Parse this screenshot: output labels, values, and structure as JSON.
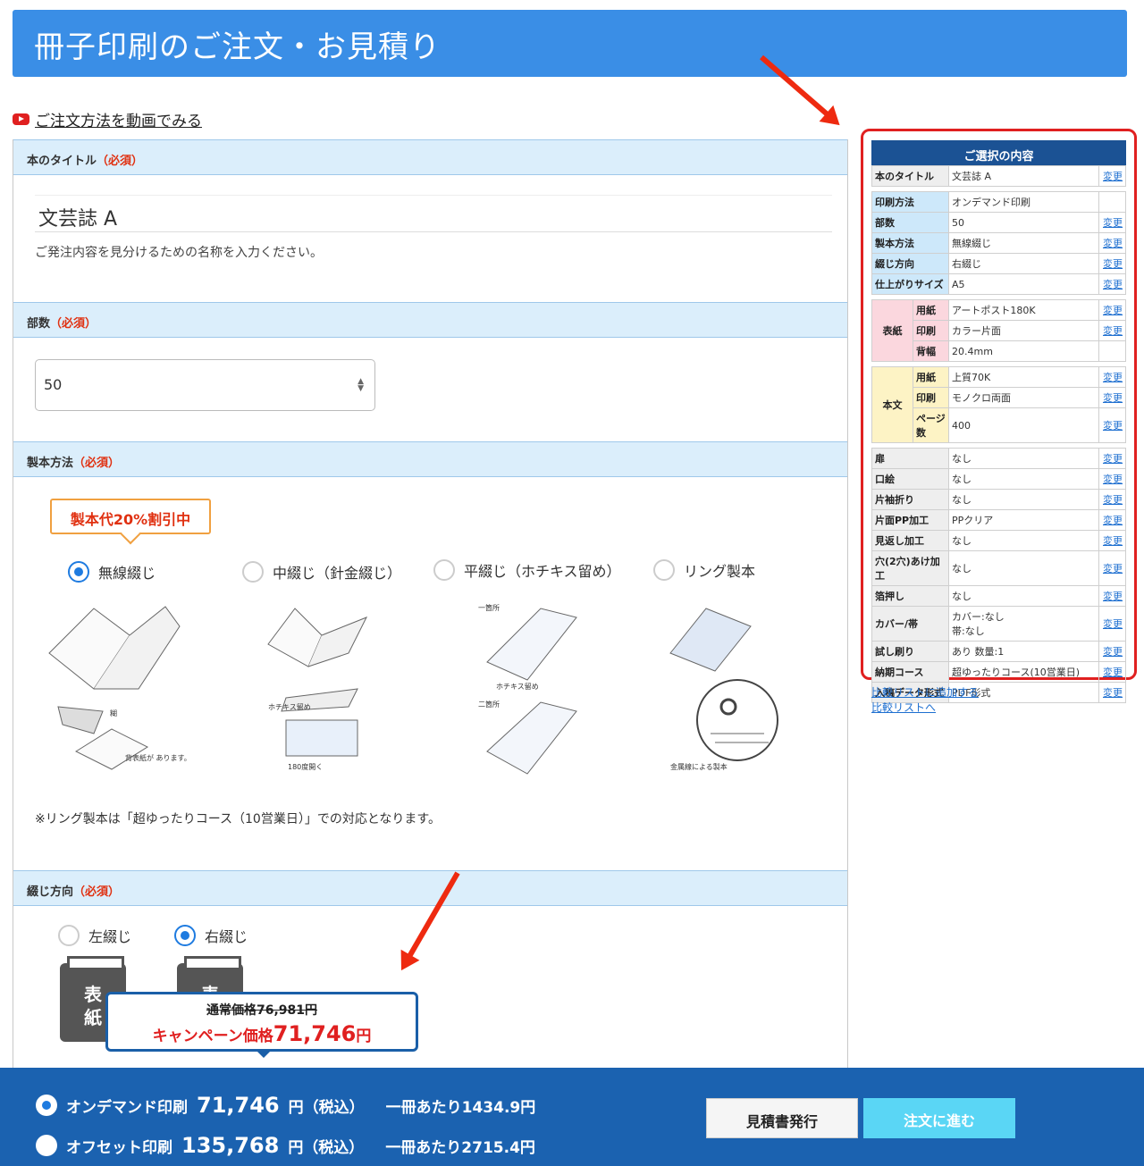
{
  "header": {
    "title": "冊子印刷のご注文・お見積り"
  },
  "video_link": "ご注文方法を動画でみる",
  "sections": {
    "title": {
      "label": "本のタイトル",
      "req": "（必須）",
      "value": "文芸誌 A",
      "hint": "ご発注内容を見分けるための名称を入力ください。"
    },
    "quantity": {
      "label": "部数",
      "req": "（必須）",
      "value": "50"
    },
    "binding": {
      "label": "製本方法",
      "req": "（必須）",
      "sale_tag": "製本代20%割引中",
      "options": [
        "無線綴じ",
        "中綴じ（針金綴じ）",
        "平綴じ（ホチキス留め）",
        "リング製本"
      ],
      "note": "※リング製本は「超ゆったりコース（10営業日）」での対応となります。",
      "illus": {
        "glue": "糊",
        "spine": "背表紙が\nあります。",
        "staple": "ホチキス留め",
        "open180": "180度開く",
        "one_spot": "一箇所",
        "two_spot": "二箇所",
        "staple2": "ホチキス留め",
        "ring": "金属線による製本"
      }
    },
    "direction": {
      "label": "綴じ方向",
      "req": "（必須）",
      "options": [
        "左綴じ",
        "右綴じ"
      ],
      "book_text": "表\n紙"
    }
  },
  "price_popup": {
    "normal": "通常価格76,981円",
    "camp_label": "キャンペーン価格",
    "camp_value": "71,746",
    "camp_unit": "円"
  },
  "footer": {
    "ondemand": {
      "label": "オンデマンド印刷",
      "price": "71,746",
      "unit": "円（税込）",
      "per": "一冊あたり1434.9円"
    },
    "offset": {
      "label": "オフセット印刷",
      "price": "135,768",
      "unit": "円（税込）",
      "per": "一冊あたり2715.4円"
    },
    "estimate_btn": "見積書発行",
    "order_btn": "注文に進む"
  },
  "summary": {
    "head": "ご選択の内容",
    "change": "変更",
    "rows1": [
      {
        "k": "本のタイトル",
        "v": "文芸誌 A"
      }
    ],
    "rows2": [
      {
        "k": "印刷方法",
        "v": "オンデマンド印刷",
        "c": false
      },
      {
        "k": "部数",
        "v": "50"
      },
      {
        "k": "製本方法",
        "v": "無線綴じ"
      },
      {
        "k": "綴じ方向",
        "v": "右綴じ"
      },
      {
        "k": "仕上がりサイズ",
        "v": "A5"
      }
    ],
    "cover": {
      "k": "表紙",
      "rows": [
        {
          "s": "用紙",
          "v": "アートポスト180K"
        },
        {
          "s": "印刷",
          "v": "カラー片面"
        },
        {
          "s": "背幅",
          "v": "20.4mm",
          "c": false
        }
      ]
    },
    "body": {
      "k": "本文",
      "rows": [
        {
          "s": "用紙",
          "v": "上質70K"
        },
        {
          "s": "印刷",
          "v": "モノクロ両面"
        },
        {
          "s": "ページ数",
          "v": "400"
        }
      ]
    },
    "rows3": [
      {
        "k": "扉",
        "v": "なし"
      },
      {
        "k": "口絵",
        "v": "なし"
      },
      {
        "k": "片袖折り",
        "v": "なし"
      },
      {
        "k": "片面PP加工",
        "v": "PPクリア"
      },
      {
        "k": "見返し加工",
        "v": "なし"
      },
      {
        "k": "穴(2穴)あけ加工",
        "v": "なし"
      },
      {
        "k": "箔押し",
        "v": "なし"
      },
      {
        "k": "カバー/帯",
        "v": "カバー:なし\n帯:なし"
      },
      {
        "k": "試し刷り",
        "v": "あり 数量:1"
      },
      {
        "k": "納期コース",
        "v": "超ゆったりコース(10営業日)"
      },
      {
        "k": "入稿データ形式",
        "v": "PDF形式"
      }
    ],
    "compare_add": "比較リストに追加する",
    "compare_go": "比較リストへ"
  },
  "colors": {
    "header": "#3a8ee6",
    "footer": "#1b62b0",
    "accent_red": "#e02020",
    "order_btn": "#5ad6f5"
  }
}
